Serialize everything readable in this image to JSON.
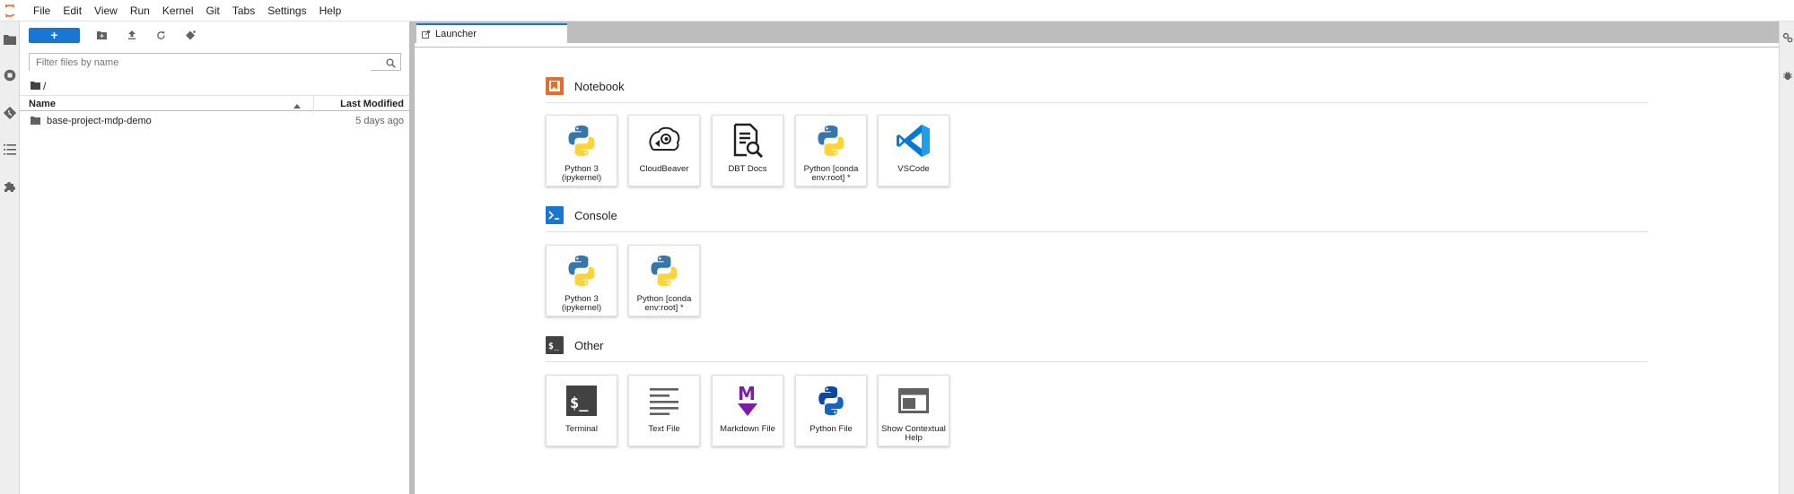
{
  "app": {
    "menu": [
      "File",
      "Edit",
      "View",
      "Run",
      "Kernel",
      "Git",
      "Tabs",
      "Settings",
      "Help"
    ]
  },
  "filebrowser": {
    "new_label": "+",
    "filter_placeholder": "Filter files by name",
    "breadcrumb": "/",
    "col_name": "Name",
    "col_modified": "Last Modified",
    "items": [
      {
        "name": "base-project-mdp-demo",
        "modified": "5 days ago",
        "icon": "folder-icon"
      }
    ]
  },
  "tabs": [
    {
      "label": "Launcher",
      "icon": "launcher-icon"
    }
  ],
  "launcher": {
    "sections": [
      {
        "title": "Notebook",
        "icon": "notebook-icon",
        "color": "#e46e2e",
        "cards": [
          {
            "label": "Python 3 (ipykernel)",
            "icon": "python-icon"
          },
          {
            "label": "CloudBeaver",
            "icon": "cloudbeaver-icon"
          },
          {
            "label": "DBT Docs",
            "icon": "dbt-docs-icon"
          },
          {
            "label": "Python [conda env:root] *",
            "icon": "python-icon"
          },
          {
            "label": "VSCode",
            "icon": "vscode-icon"
          }
        ]
      },
      {
        "title": "Console",
        "icon": "console-icon",
        "color": "#1976d2",
        "cards": [
          {
            "label": "Python 3 (ipykernel)",
            "icon": "python-icon"
          },
          {
            "label": "Python [conda env:root] *",
            "icon": "python-icon"
          }
        ]
      },
      {
        "title": "Other",
        "icon": "other-icon",
        "color": "#424242",
        "cards": [
          {
            "label": "Terminal",
            "icon": "terminal-icon"
          },
          {
            "label": "Text File",
            "icon": "text-file-icon"
          },
          {
            "label": "Markdown File",
            "icon": "markdown-icon"
          },
          {
            "label": "Python File",
            "icon": "python-file-icon"
          },
          {
            "label": "Show Contextual Help",
            "icon": "contextual-help-icon"
          }
        ]
      }
    ]
  },
  "colors": {
    "accent": "#1976d2",
    "jupyter_orange": "#f37726",
    "python_blue": "#3776ab",
    "python_yellow": "#ffd43b",
    "markdown_purple": "#7b1fa2",
    "vscode_blue": "#0078d4"
  }
}
